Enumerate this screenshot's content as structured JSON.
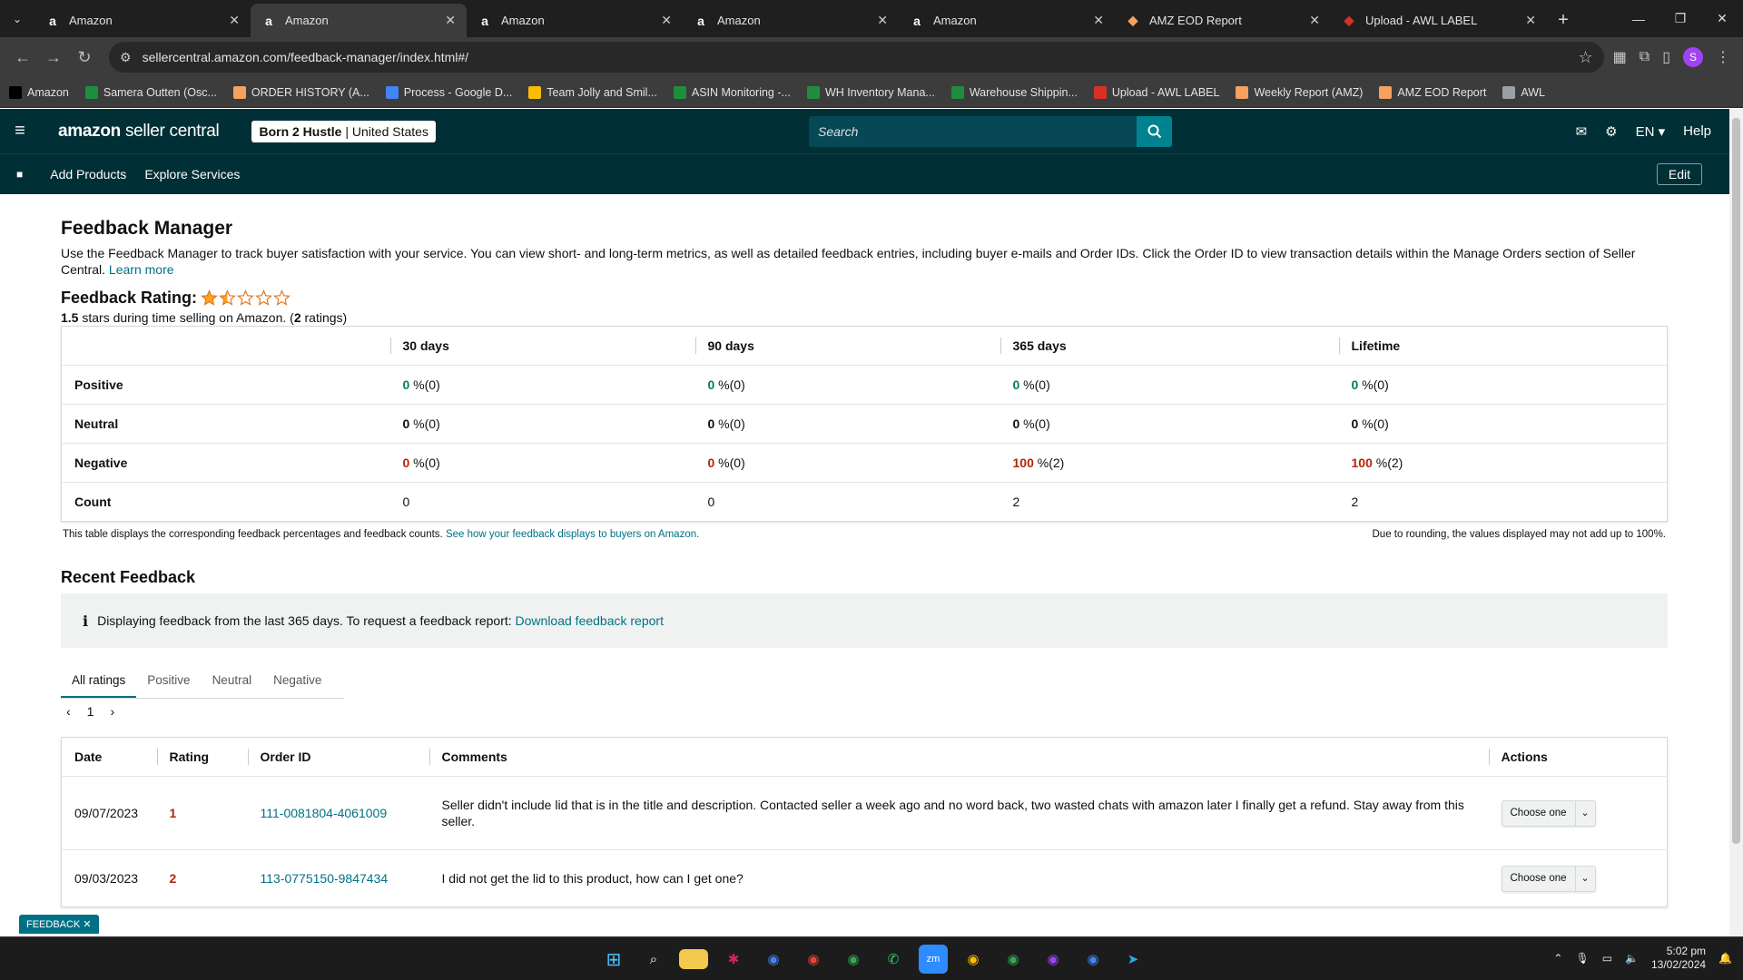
{
  "browser": {
    "tabs": [
      {
        "title": "Amazon",
        "icon": "amazon-icon",
        "active": false
      },
      {
        "title": "Amazon",
        "icon": "amazon-icon",
        "active": true
      },
      {
        "title": "Amazon",
        "icon": "amazon-icon",
        "active": false
      },
      {
        "title": "Amazon",
        "icon": "amazon-icon",
        "active": false
      },
      {
        "title": "Amazon",
        "icon": "amazon-icon",
        "active": false
      },
      {
        "title": "AMZ EOD Report",
        "icon": "report-icon",
        "active": false
      },
      {
        "title": "Upload - AWL LABEL",
        "icon": "awl-icon",
        "active": false
      }
    ],
    "url": "sellercentral.amazon.com/feedback-manager/index.html#/",
    "profile_initial": "S",
    "bookmarks": [
      {
        "label": "Amazon",
        "color": "#000000"
      },
      {
        "label": "Samera Outten (Osc...",
        "color": "#1e8e3e"
      },
      {
        "label": "ORDER HISTORY (A...",
        "color": "#f4a261"
      },
      {
        "label": "Process - Google D...",
        "color": "#4285f4"
      },
      {
        "label": "Team Jolly and Smil...",
        "color": "#fbbc04"
      },
      {
        "label": "ASIN Monitoring -...",
        "color": "#1e8e3e"
      },
      {
        "label": "WH Inventory Mana...",
        "color": "#1e8e3e"
      },
      {
        "label": "Warehouse Shippin...",
        "color": "#1e8e3e"
      },
      {
        "label": "Upload - AWL LABEL",
        "color": "#d93025"
      },
      {
        "label": "Weekly Report (AMZ)",
        "color": "#f4a261"
      },
      {
        "label": "AMZ EOD Report",
        "color": "#f4a261"
      },
      {
        "label": "AWL",
        "color": "#9aa0a6"
      }
    ]
  },
  "header": {
    "logo_main": "amazon",
    "logo_sub": "seller central",
    "store_name": "Born 2 Hustle",
    "store_region": "United States",
    "search_placeholder": "Search",
    "language": "EN",
    "help": "Help",
    "nav": [
      "Add Products",
      "Explore Services"
    ],
    "edit": "Edit"
  },
  "page": {
    "title": "Feedback Manager",
    "intro": "Use the Feedback Manager to track buyer satisfaction with your service. You can view short- and long-term metrics, as well as detailed feedback entries, including buyer e-mails and Order IDs. Click the Order ID to view transaction details within the Manage Orders section of Seller Central.",
    "learn_more": "Learn more",
    "rating_label": "Feedback Rating:",
    "rating_value": 1.5,
    "rating_stars_text": "1.5",
    "rating_sub_middle": "stars during time selling on Amazon. (",
    "rating_count": "2",
    "rating_sub_end": "ratings)"
  },
  "summary": {
    "columns": [
      "",
      "30 days",
      "90 days",
      "365 days",
      "Lifetime"
    ],
    "rows": [
      {
        "label": "Positive",
        "cells": [
          [
            "0",
            " %(0)"
          ],
          [
            "0",
            " %(0)"
          ],
          [
            "0",
            " %(0)"
          ],
          [
            "0",
            " %(0)"
          ]
        ]
      },
      {
        "label": "Neutral",
        "cells": [
          [
            "0",
            " %(0)"
          ],
          [
            "0",
            " %(0)"
          ],
          [
            "0",
            " %(0)"
          ],
          [
            "0",
            " %(0)"
          ]
        ]
      },
      {
        "label": "Negative",
        "cells": [
          [
            "0",
            " %(0)"
          ],
          [
            "0",
            " %(0)"
          ],
          [
            "100",
            " %(2)"
          ],
          [
            "100",
            " %(2)"
          ]
        ]
      },
      {
        "label": "Count",
        "cells": [
          [
            "0",
            ""
          ],
          [
            "0",
            ""
          ],
          [
            "2",
            ""
          ],
          [
            "2",
            ""
          ]
        ]
      }
    ],
    "note_left": "This table displays the corresponding feedback percentages and feedback counts.",
    "note_link": "See how your feedback displays to buyers on Amazon.",
    "note_right": "Due to rounding, the values displayed may not add up to 100%.",
    "colors": {
      "positive": "#067d62",
      "negative": "#b12704"
    }
  },
  "recent": {
    "title": "Recent Feedback",
    "info": "Displaying feedback from the last 365 days. To request a feedback report:",
    "info_link": "Download feedback report",
    "tabs": [
      "All ratings",
      "Positive",
      "Neutral",
      "Negative"
    ],
    "page": "1",
    "columns": [
      "Date",
      "Rating",
      "Order ID",
      "Comments",
      "Actions"
    ],
    "rows": [
      {
        "date": "09/07/2023",
        "rating": "1",
        "order_id": "111-0081804-4061009",
        "comment": "Seller didn't include lid that is in the title and description. Contacted seller a week ago and no word back, two wasted chats with amazon later I finally get a refund. Stay away from this seller.",
        "action": "Choose one"
      },
      {
        "date": "09/03/2023",
        "rating": "2",
        "order_id": "113-0775150-9847434",
        "comment": "I did not get the lid to this product, how can I get one?",
        "action": "Choose one"
      }
    ]
  },
  "feedback_tab": "FEEDBACK",
  "taskbar": {
    "time": "5:02 pm",
    "date": "13/02/2024"
  }
}
